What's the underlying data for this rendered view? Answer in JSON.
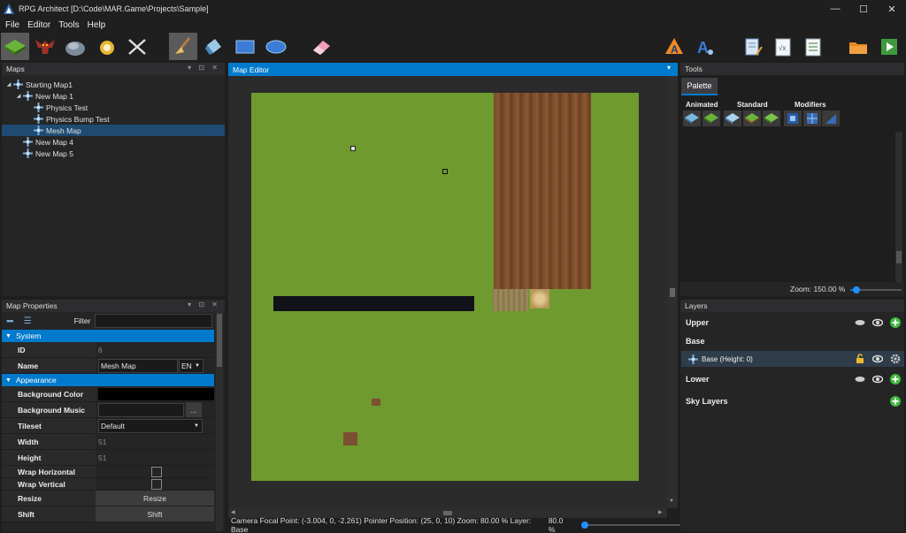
{
  "window": {
    "title": "RPG Architect [D:\\Code\\MAR.Game\\Projects\\Sample]",
    "controls": [
      "—",
      "☐",
      "✕"
    ]
  },
  "menu": [
    "File",
    "Editor",
    "Tools",
    "Help"
  ],
  "maps_panel": {
    "title": "Maps",
    "tree": [
      {
        "label": "Starting Map1",
        "level": 0,
        "expanded": true
      },
      {
        "label": "New Map 1",
        "level": 1,
        "expanded": true
      },
      {
        "label": "Physics Test",
        "level": 2
      },
      {
        "label": "Physics Bump Test",
        "level": 2
      },
      {
        "label": "Mesh Map",
        "level": 2,
        "selected": true
      },
      {
        "label": "New Map 4",
        "level": 1
      },
      {
        "label": "New Map 5",
        "level": 1
      }
    ]
  },
  "properties_panel": {
    "title": "Map Properties",
    "filter_label": "Filter",
    "filter_value": "",
    "categories": {
      "system": "System",
      "appearance": "Appearance"
    },
    "rows": {
      "id": {
        "name": "ID",
        "value": "6"
      },
      "name": {
        "name": "Name",
        "value": "Mesh Map",
        "lang": "EN"
      },
      "bg_color": {
        "name": "Background Color",
        "value": "#000000"
      },
      "bg_music": {
        "name": "Background Music",
        "value": "",
        "browse": "..."
      },
      "tileset": {
        "name": "Tileset",
        "value": "Default"
      },
      "width": {
        "name": "Width",
        "value": "51"
      },
      "height": {
        "name": "Height",
        "value": "51"
      },
      "wrap_h": {
        "name": "Wrap Horizontal",
        "checked": false
      },
      "wrap_v": {
        "name": "Wrap Vertical",
        "checked": false
      },
      "resize": {
        "name": "Resize",
        "button": "Resize"
      },
      "shift": {
        "name": "Shift",
        "button": "Shift"
      }
    }
  },
  "map_editor": {
    "title": "Map Editor",
    "status": "Camera Focal Point: (-3.004, 0, -2.261) Pointer Position: (25, 0, 10) Zoom: 80.00 % Layer: Base",
    "zoom_label": "80.0 %",
    "zoom_fraction": 0.0
  },
  "tools_panel": {
    "title": "Tools",
    "tab": "Palette",
    "groups": [
      "Animated",
      "Standard",
      "Modifiers"
    ],
    "zoom_label": "Zoom: 150.00 %",
    "zoom_fraction": 0.05
  },
  "layers_panel": {
    "title": "Layers",
    "items": {
      "upper": "Upper",
      "base": "Base",
      "base_child": "Base (Height: 0)",
      "lower": "Lower",
      "sky": "Sky Layers"
    }
  },
  "colors": {
    "accent": "#007acc",
    "bg": "#1e1e1e",
    "panel": "#252526",
    "grass": "#6f9a2f",
    "add": "#3dbb3d"
  }
}
